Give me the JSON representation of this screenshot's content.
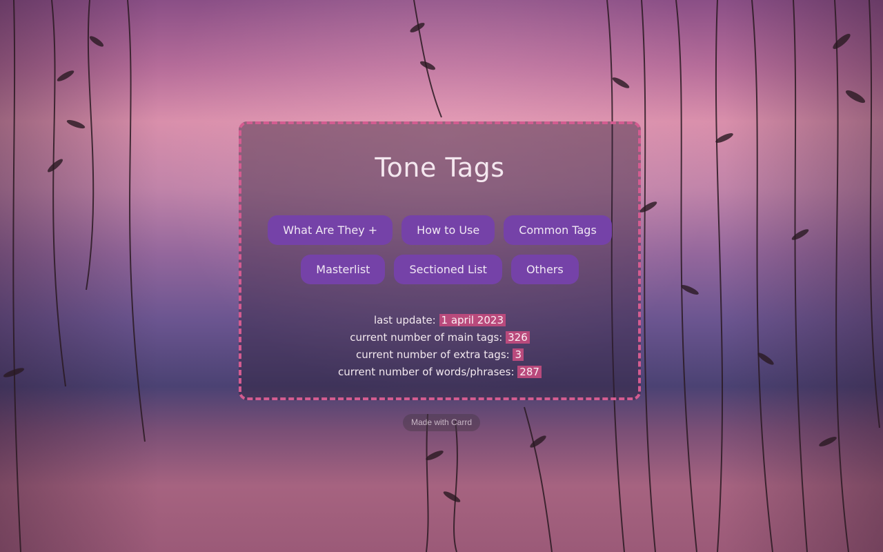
{
  "page": {
    "title": "Tone Tags"
  },
  "nav": {
    "row1": [
      {
        "label": "What Are They +"
      },
      {
        "label": "How to Use"
      },
      {
        "label": "Common Tags"
      }
    ],
    "row2": [
      {
        "label": "Masterlist"
      },
      {
        "label": "Sectioned List"
      },
      {
        "label": "Others"
      }
    ]
  },
  "stats": {
    "last_update_label": "last update:",
    "last_update_value": "1 april 2023",
    "main_tags_label": "current number of main tags:",
    "main_tags_value": "326",
    "extra_tags_label": "current number of extra tags:",
    "extra_tags_value": "3",
    "words_label": "current number of words/phrases:",
    "words_value": "287"
  },
  "footer": {
    "made_with": "Made with Carrd"
  },
  "colors": {
    "border": "#d35c90",
    "button": "#7542a8",
    "highlight": "#b94a7c"
  }
}
